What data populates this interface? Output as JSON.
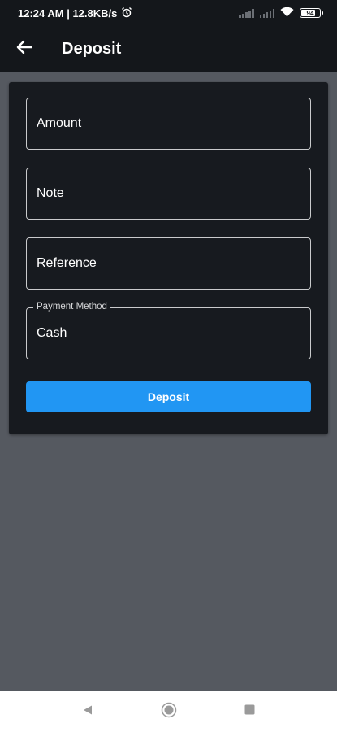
{
  "status_bar": {
    "time_speed": "12:24 AM | 12.8KB/s",
    "battery_level": "94"
  },
  "app_bar": {
    "title": "Deposit"
  },
  "form": {
    "amount_label": "Amount",
    "note_label": "Note",
    "reference_label": "Reference",
    "payment_method_label": "Payment Method",
    "payment_method_value": "Cash",
    "submit_label": "Deposit"
  },
  "colors": {
    "app_bar_bg": "#14171b",
    "card_bg": "#171a1f",
    "page_bg": "#555960",
    "accent": "#2196f3"
  },
  "icons": {
    "back": "arrow-left-icon",
    "alarm": "alarm-clock-icon",
    "wifi": "wifi-icon",
    "signal": "signal-icon",
    "battery": "battery-icon",
    "nav_back": "triangle-back-icon",
    "nav_home": "circle-home-icon",
    "nav_recents": "square-recents-icon"
  }
}
